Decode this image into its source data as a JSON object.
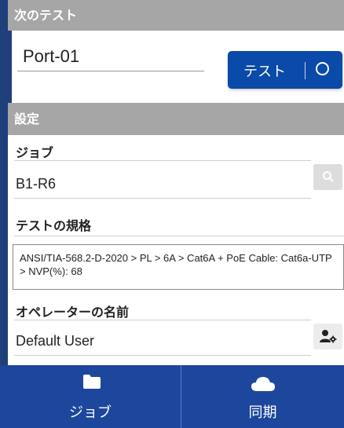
{
  "next_test": {
    "header": "次のテスト",
    "port_label": "Port-01",
    "test_button_label": "テスト"
  },
  "settings": {
    "header": "設定",
    "job_label": "ジョブ",
    "job_value": "B1-R6",
    "standard_label": "テストの規格",
    "standard_value": "ANSI/TIA-568.2-D-2020 > PL > 6A > Cat6A + PoE Cable: Cat6a-UTP > NVP(%): 68",
    "operator_label": "オペレーターの名前",
    "operator_value": "Default User"
  },
  "bottom_nav": {
    "items": [
      {
        "label": "ジョブ",
        "icon": "folder-icon"
      },
      {
        "label": "同期",
        "icon": "cloud-icon"
      }
    ]
  },
  "colors": {
    "accent": "#0a4aa8",
    "nav_bg": "#1d479c",
    "header_bg": "#a6a6a6"
  }
}
